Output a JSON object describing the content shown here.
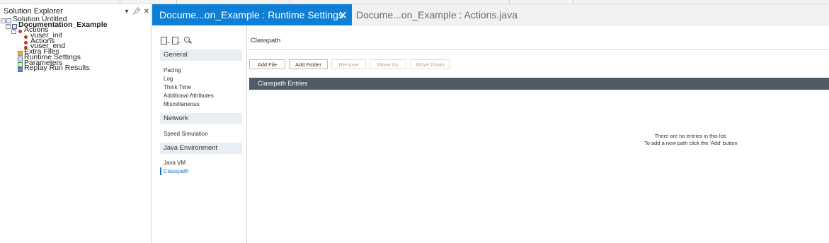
{
  "solution_explorer": {
    "title": "Solution Explorer",
    "controls": {
      "dropdown": "▾",
      "pin": "ꟷ",
      "close": "✕"
    },
    "tree": [
      {
        "label": "Solution Untitled",
        "bold": false
      },
      {
        "label": "Documentation_Example",
        "bold": true
      },
      {
        "label": "Actions",
        "bold": false
      },
      {
        "label": "vuser_init",
        "bold": false
      },
      {
        "label": "Actions",
        "bold": false
      },
      {
        "label": "vuser_end",
        "bold": false
      },
      {
        "label": "Extra Files",
        "bold": false
      },
      {
        "label": "Runtime Settings",
        "bold": false
      },
      {
        "label": "Parameters",
        "bold": false
      },
      {
        "label": "Replay Run Results",
        "bold": false
      }
    ]
  },
  "tabs": [
    {
      "label": "Docume...on_Example : Runtime Settings",
      "active": true
    },
    {
      "label": "Docume...on_Example : Actions.java",
      "active": false
    }
  ],
  "tab_close": "✕",
  "nav": {
    "tools": [
      "import-icon",
      "export-icon",
      "search-icon"
    ],
    "groups": [
      {
        "label": "General",
        "items": [
          "Pacing",
          "Log",
          "Think Time",
          "Additional Attributes",
          "Miscellaneous"
        ]
      },
      {
        "label": "Network",
        "items": [
          "Speed Simulation"
        ]
      },
      {
        "label": "Java Environment",
        "items": [
          "Java VM",
          "Classpath"
        ]
      }
    ],
    "selected": "Classpath"
  },
  "content": {
    "title": "Classpath",
    "buttons": [
      {
        "label": "Add File",
        "enabled": true
      },
      {
        "label": "Add Folder",
        "enabled": true
      },
      {
        "label": "Remove",
        "enabled": false
      },
      {
        "label": "Move Up",
        "enabled": false
      },
      {
        "label": "Move Down",
        "enabled": false
      }
    ],
    "table_header": "Classpath Entries",
    "empty_line1": "There are no entries in this list.",
    "empty_line2": "To add a new path click the 'Add' button"
  },
  "colors": {
    "active_tab": "#0f7fd6",
    "table_header": "#4f5b66",
    "nav_group_bg": "#e9eef3",
    "selected_link": "#1f6fc1"
  }
}
